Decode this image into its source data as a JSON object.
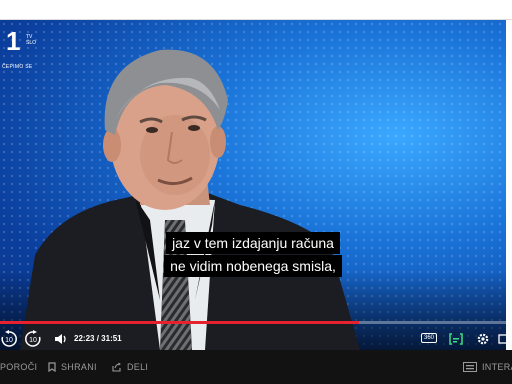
{
  "channel": {
    "number": "1",
    "sub": "TV SLO",
    "tagline": "ČEPIMO SE"
  },
  "subtitles": {
    "line1": "jaz v tem izdajanju računa",
    "line2": "ne vidim nobenega smisla,"
  },
  "player": {
    "current_time": "22:23",
    "separator": "/",
    "duration": "31:51",
    "progress": 0.71,
    "skip_back_seconds": "10",
    "skip_forward_seconds": "10",
    "badge_360": "360"
  },
  "actions": {
    "report_label": "POROČI",
    "save_label": "SHRANI",
    "share_label": "DELI",
    "interactive_label": "INTERA"
  },
  "colors": {
    "progress": "#e8212e",
    "subtitle_accent": "#3ddc84",
    "bottom_bar": "#121212"
  }
}
